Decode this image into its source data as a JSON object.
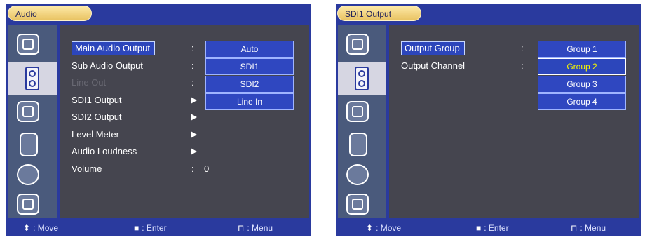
{
  "left": {
    "title": "Audio",
    "menu": [
      {
        "label": "Main Audio Output",
        "marker": ":",
        "selected": true
      },
      {
        "label": "Sub Audio Output",
        "marker": ":"
      },
      {
        "label": "Line Out",
        "marker": ":",
        "disabled": true
      },
      {
        "label": "SDI1 Output",
        "marker": "arrow"
      },
      {
        "label": "SDI2 Output",
        "marker": "arrow"
      },
      {
        "label": "Level Meter",
        "marker": "arrow"
      },
      {
        "label": "Audio Loudness",
        "marker": "arrow"
      },
      {
        "label": "Volume",
        "marker": ":",
        "value": "0"
      }
    ],
    "options": [
      "Auto",
      "SDI1",
      "SDI2",
      "Line In"
    ]
  },
  "right": {
    "title": "SDI1 Output",
    "menu": [
      {
        "label": "Output Group",
        "marker": ":",
        "selected": true
      },
      {
        "label": "Output Channel",
        "marker": ":"
      }
    ],
    "options": [
      "Group 1",
      "Group 2",
      "Group 3",
      "Group 4"
    ],
    "highlighted_option": "Group 2"
  },
  "footer": {
    "move_icon": "⬍",
    "move": ": Move",
    "enter_icon": "■",
    "enter": ": Enter",
    "menu_icon": "⊓",
    "menu": ": Menu"
  },
  "sidebar_icons": [
    "picture-icon",
    "speaker-icon",
    "crosshair-icon",
    "remote-icon",
    "globe-icon",
    "tv-icon"
  ]
}
